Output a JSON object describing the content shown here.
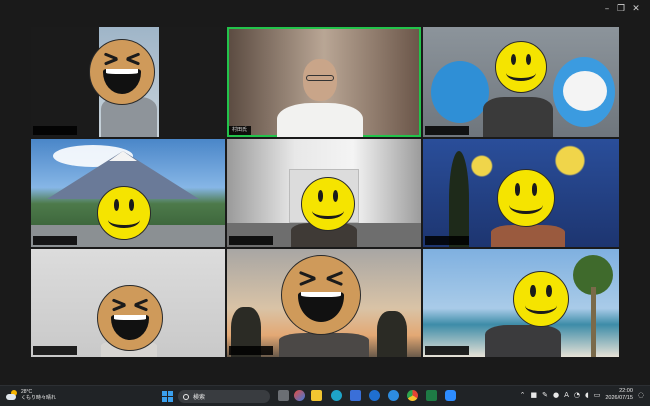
{
  "window": {
    "controls": [
      "minimize",
      "restore",
      "close"
    ]
  },
  "tiles": [
    {
      "id": "1",
      "name_label": ""
    },
    {
      "id": "2",
      "name_label": "村田氏"
    },
    {
      "id": "3",
      "name_label": ""
    },
    {
      "id": "4",
      "name_label": ""
    },
    {
      "id": "5",
      "name_label": ""
    },
    {
      "id": "6",
      "name_label": ""
    },
    {
      "id": "7",
      "name_label": ""
    },
    {
      "id": "8",
      "name_label": ""
    },
    {
      "id": "9",
      "name_label": ""
    }
  ],
  "active_speaker_color": "#23c34b",
  "taskbar": {
    "weather_temp": "28°C",
    "weather_desc": "くもり時々晴れ",
    "search_placeholder": "検索",
    "time": "22:00",
    "date": "2026/07/15"
  }
}
